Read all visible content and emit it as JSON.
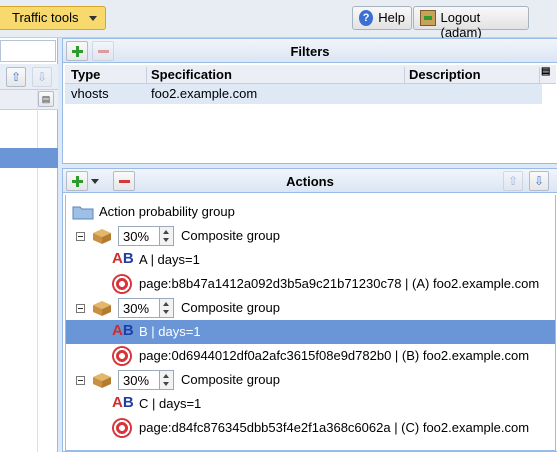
{
  "topbar": {
    "traffic_tools": "Traffic tools",
    "help": "Help",
    "logout": "Logout (adam)"
  },
  "filters": {
    "title": "Filters",
    "columns": {
      "type": "Type",
      "specification": "Specification",
      "description": "Description"
    },
    "rows": [
      {
        "type": "vhosts",
        "specification": "foo2.example.com",
        "description": ""
      }
    ]
  },
  "actions": {
    "title": "Actions",
    "root_label": "Action probability group",
    "groups": [
      {
        "percent": "30%",
        "label": "Composite group",
        "ab_label": "A | days=1",
        "page_label": "page:b8b47a1412a092d3b5a9c21b71230c78 | (A) foo2.example.com"
      },
      {
        "percent": "30%",
        "label": "Composite group",
        "ab_label": "B | days=1",
        "page_label": "page:0d6944012df0a2afc3615f08e9d782b0 | (B) foo2.example.com"
      },
      {
        "percent": "30%",
        "label": "Composite group",
        "ab_label": "C | days=1",
        "page_label": "page:d84fc876345dbb53f4e2f1a368c6062a | (C) foo2.example.com"
      }
    ]
  }
}
